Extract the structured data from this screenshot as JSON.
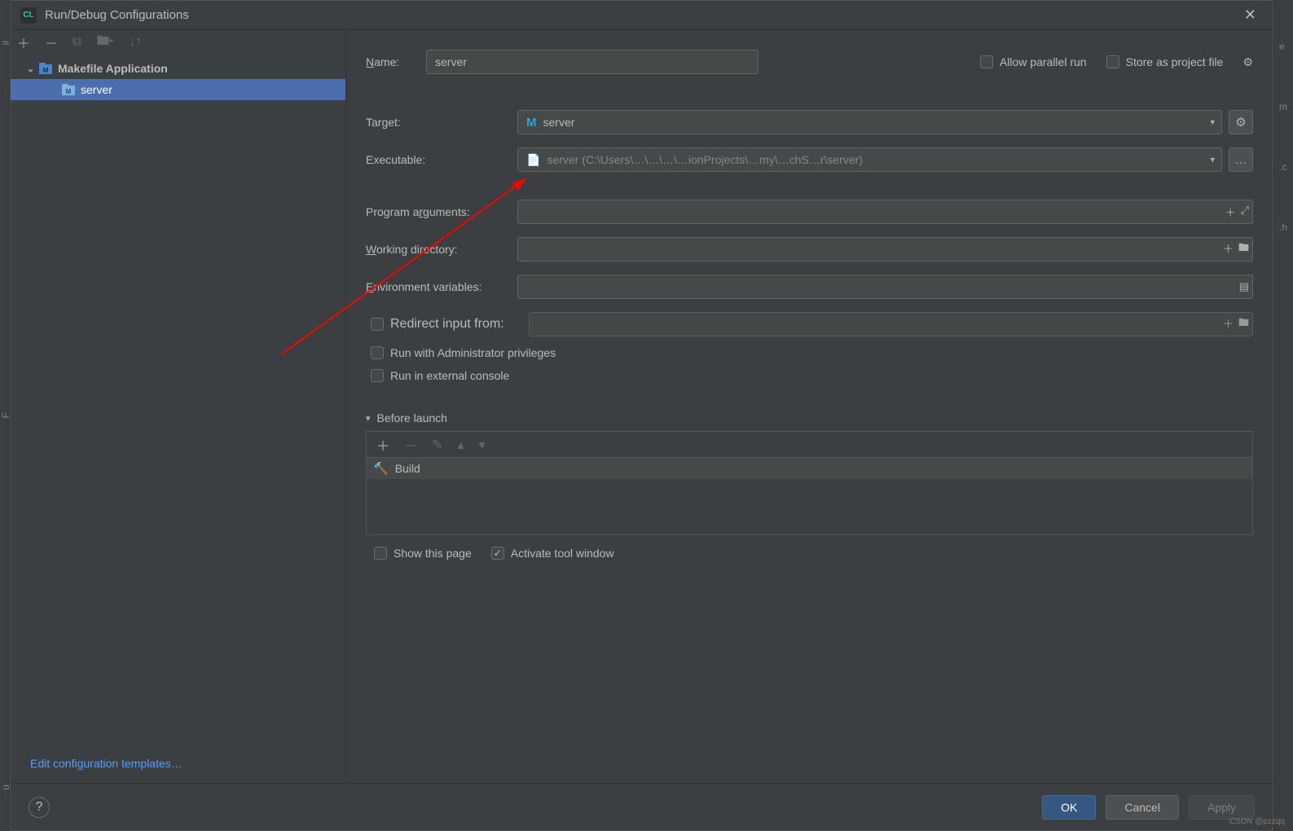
{
  "window": {
    "title": "Run/Debug Configurations"
  },
  "tree": {
    "group_label": "Makefile Application",
    "item_label": "server"
  },
  "left_footer": {
    "templates_link": "Edit configuration templates…"
  },
  "form": {
    "name_label": "Name:",
    "name_value": "server",
    "allow_parallel_label": "Allow parallel run",
    "store_project_label": "Store as project file",
    "target_label": "Target:",
    "target_value": "server",
    "executable_label": "Executable:",
    "executable_value": "server (C:\\Users\\…\\…\\…\\…ionProjects\\…my\\…chS…r\\server)",
    "args_label": "Program arguments:",
    "args_value": "",
    "workdir_label": "Working directory:",
    "workdir_value": "",
    "env_label": "Environment variables:",
    "env_value": "",
    "redirect_label": "Redirect input from:",
    "admin_label": "Run with Administrator privileges",
    "extconsole_label": "Run in external console",
    "before_launch_label": "Before launch",
    "build_label": "Build",
    "show_page_label": "Show this page",
    "activate_window_label": "Activate tool window"
  },
  "buttons": {
    "ok": "OK",
    "cancel": "Cancel",
    "apply": "Apply"
  },
  "watermark": "CSDN @pzzqq"
}
